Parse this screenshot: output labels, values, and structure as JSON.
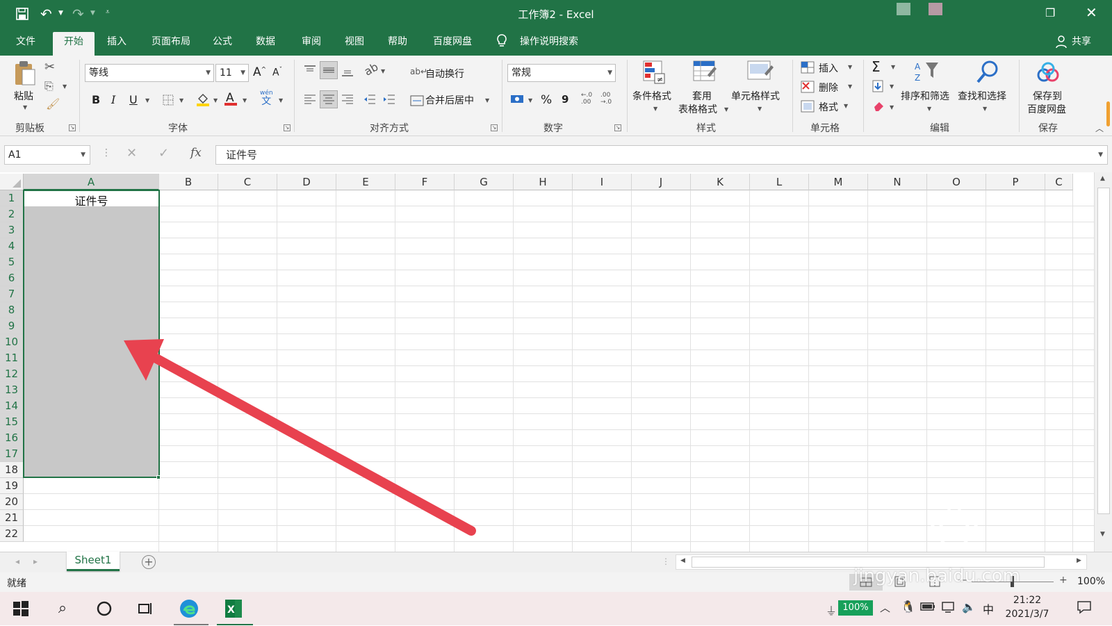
{
  "app": {
    "window_title": "工作簿2  -  Excel",
    "share_label": "共享",
    "tell_me": "操作说明搜索"
  },
  "tabs": [
    "文件",
    "开始",
    "插入",
    "页面布局",
    "公式",
    "数据",
    "审阅",
    "视图",
    "帮助",
    "百度网盘"
  ],
  "ribbon": {
    "clipboard": {
      "paste": "粘贴",
      "group": "剪贴板"
    },
    "font": {
      "name": "等线",
      "size": "11",
      "group": "字体",
      "bold": "B",
      "italic": "I",
      "underline": "U",
      "grow": "A",
      "shrink": "A",
      "phonetic": "wén",
      "phonetic_char": "文"
    },
    "alignment": {
      "wrap": "自动换行",
      "merge": "合并后居中",
      "group": "对齐方式"
    },
    "number": {
      "format": "常规",
      "percent": "%",
      "comma": "9",
      "inc_decimal": "←.0\n.00",
      "dec_decimal": ".00\n→.0",
      "group": "数字"
    },
    "styles": {
      "cond": "条件格式",
      "table1": "套用",
      "table2": "表格格式",
      "cell": "单元格样式",
      "group": "样式"
    },
    "cells": {
      "insert": "插入",
      "delete": "删除",
      "format": "格式",
      "group": "单元格"
    },
    "editing": {
      "sum": "Σ",
      "sort": "排序和筛选",
      "find": "查找和选择",
      "group": "编辑"
    },
    "save": {
      "line1": "保存到",
      "line2": "百度网盘",
      "group": "保存"
    }
  },
  "formula_bar": {
    "name_box": "A1",
    "fx": "fx",
    "content": "证件号"
  },
  "grid": {
    "columns": [
      "A",
      "B",
      "C",
      "D",
      "E",
      "F",
      "G",
      "H",
      "I",
      "J",
      "K",
      "L",
      "M",
      "N",
      "O",
      "P",
      "C"
    ],
    "rows": [
      "1",
      "2",
      "3",
      "4",
      "5",
      "6",
      "7",
      "8",
      "9",
      "10",
      "11",
      "12",
      "13",
      "14",
      "15",
      "16",
      "17",
      "18",
      "19",
      "20",
      "21",
      "22"
    ],
    "cell_a1": "证件号",
    "selection": "A1:A17"
  },
  "sheets": {
    "tabs": [
      "Sheet1"
    ],
    "add": "+"
  },
  "status": {
    "ready": "就绪",
    "zoom": "100%",
    "zoom_minus": "—",
    "zoom_plus": "+"
  },
  "taskbar": {
    "battery": "100%",
    "ime": "中",
    "time": "21:22",
    "date": "2021/3/7"
  },
  "watermark": "jingyan.baidu.com",
  "colors": {
    "excel_green": "#217346",
    "arrow_red": "#e8424f",
    "selection_fill": "#c8c8c8"
  }
}
